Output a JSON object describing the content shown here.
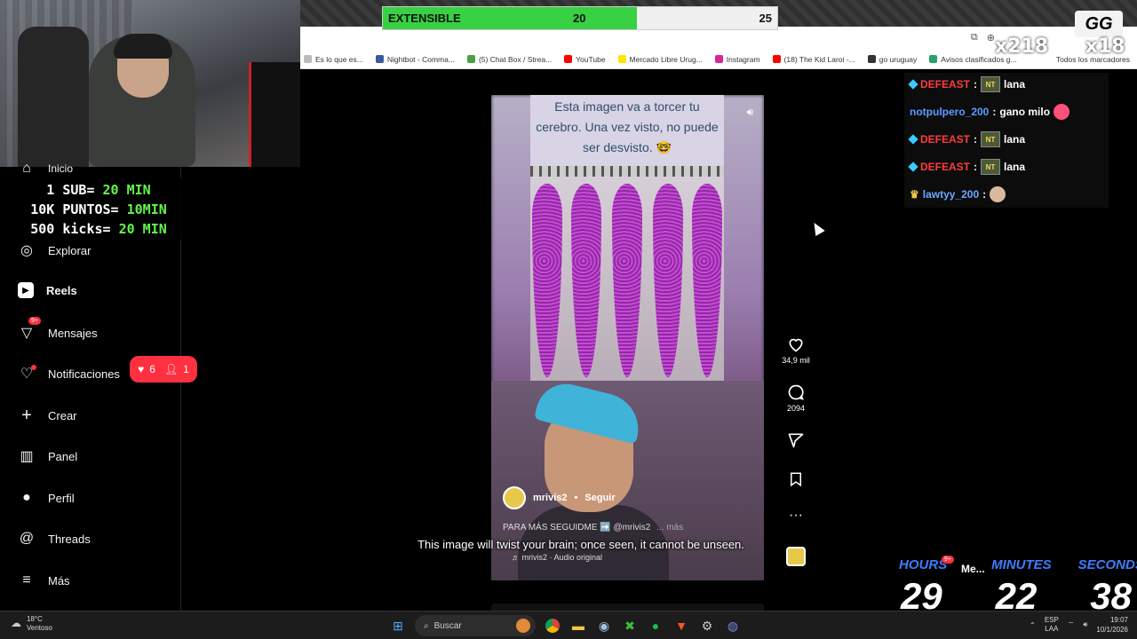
{
  "goal": {
    "label": "EXTENSIBLE",
    "current": "20",
    "target": "25",
    "progress": 0.8
  },
  "bookmarks": [
    {
      "label": "Es lo que es...",
      "color": "#bbbbbb"
    },
    {
      "label": "Nightbot - Comma...",
      "color": "#3b5a9a"
    },
    {
      "label": "(5) Chat Box / Strea...",
      "color": "#4aa04a"
    },
    {
      "label": "YouTube",
      "color": "#ff0000"
    },
    {
      "label": "Mercado Libre Urug...",
      "color": "#ffe600"
    },
    {
      "label": "Instagram",
      "color": "#d6249f"
    },
    {
      "label": "(18) The Kid Laroi -...",
      "color": "#ff0000"
    },
    {
      "label": "go uruguay",
      "color": "#333333"
    },
    {
      "label": "Avisos clasificados g...",
      "color": "#2aa36b"
    }
  ],
  "bookmarks_all": "Todos los marcadores",
  "sidebar": {
    "items": [
      {
        "label": "Inicio",
        "icon": "home-icon",
        "name": "sidebar-item-inicio"
      },
      {
        "label": "Explorar",
        "icon": "compass-icon",
        "name": "sidebar-item-explorar"
      },
      {
        "label": "Reels",
        "icon": "reels-icon",
        "name": "sidebar-item-reels"
      },
      {
        "label": "Mensajes",
        "icon": "messenger-icon",
        "name": "sidebar-item-mensajes"
      },
      {
        "label": "Notificaciones",
        "icon": "heart-icon",
        "name": "sidebar-item-notificaciones"
      },
      {
        "label": "Crear",
        "icon": "plus-icon",
        "name": "sidebar-item-crear"
      },
      {
        "label": "Panel",
        "icon": "chart-icon",
        "name": "sidebar-item-panel"
      },
      {
        "label": "Perfil",
        "icon": "avatar-icon",
        "name": "sidebar-item-perfil"
      },
      {
        "label": "Threads",
        "icon": "threads-icon",
        "name": "sidebar-item-threads"
      },
      {
        "label": "Más",
        "icon": "menu-icon",
        "name": "sidebar-item-mas"
      }
    ],
    "messages_badge": "9+",
    "notif_likes": "6",
    "notif_follows": "1"
  },
  "sub_overlay": {
    "line1_a": "1 SUB= ",
    "line1_b": "20 MIN",
    "line2_a": "10K PUNTOS= ",
    "line2_b": "10MIN",
    "line3_a": "500 kicks= ",
    "line3_b": "20 MIN"
  },
  "reel": {
    "caption_text": "Esta imagen va a torcer tu cerebro. Una vez visto, no puede ser desvisto. 🤓",
    "username": "mrivis2",
    "follow": "Seguir",
    "separator": "•",
    "description": "PARA MÁS SEGUIDME ➡️ @mrivis2",
    "more": "... más",
    "audio": "mrivis2 · Audio original",
    "subtitle": "This image will twist your brain; once seen, it cannot be unseen."
  },
  "actions": {
    "likes": "34,9 mil",
    "comments": "2094"
  },
  "chat": [
    {
      "user": "DEFEAST",
      "sep": ":",
      "msg": "lana",
      "style": "red",
      "badge": "gem",
      "emote": "NT"
    },
    {
      "user": "notpulpero_200",
      "sep": ":",
      "msg": "gano milo",
      "style": "blue",
      "badge": "",
      "emote": "heart"
    },
    {
      "user": "DEFEAST",
      "sep": ":",
      "msg": "lana",
      "style": "red",
      "badge": "gem",
      "emote": "NT"
    },
    {
      "user": "DEFEAST",
      "sep": ":",
      "msg": "lana",
      "style": "red",
      "badge": "gem",
      "emote": "NT"
    },
    {
      "user": "lawtyy_200",
      "sep": ":",
      "msg": "",
      "style": "teal",
      "badge": "crown",
      "emote": "face"
    }
  ],
  "emotes": {
    "multiplier_a": "x218",
    "gg": "GG",
    "multiplier_b": "x18"
  },
  "timer": {
    "hours_label": "HOURS",
    "minutes_label": "MINUTES",
    "seconds_label": "SECONDS",
    "hours": "29",
    "minutes": "22",
    "seconds": "38",
    "msg_chip": "Me...",
    "msg_badge": "9+"
  },
  "taskbar": {
    "temp": "18°C",
    "weather": "Ventoso",
    "search": "Buscar",
    "lang1": "ESP",
    "lang2": "LAA",
    "time": "19:07",
    "date": "10/1/2026"
  },
  "colors": {
    "accent_red": "#ff3040",
    "goal_green": "#37d143",
    "timer_blue": "#3f7bff"
  }
}
